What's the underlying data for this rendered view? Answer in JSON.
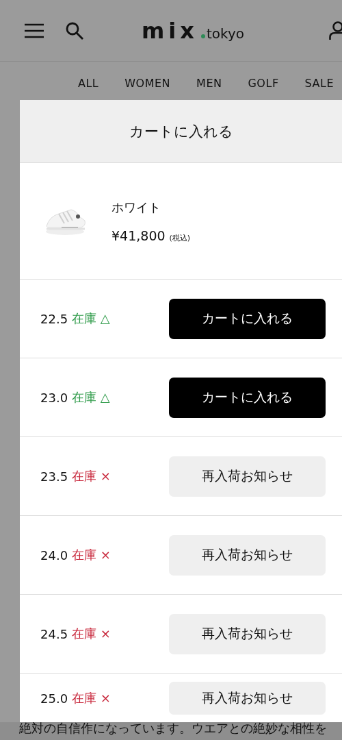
{
  "header": {
    "logo_main": "mix",
    "logo_suffix": "tokyo"
  },
  "nav": [
    "ALL",
    "WOMEN",
    "MEN",
    "GOLF",
    "SALE"
  ],
  "modal": {
    "title": "カートに入れる",
    "product": {
      "kind": "picture",
      "color_name": "ホワイト",
      "price": "¥41,800",
      "tax_note": "(税込)"
    },
    "sizes": [
      {
        "size": "22.5",
        "stock_label": "在庫",
        "stock_mark": "△",
        "in_stock": true,
        "kind": "cart",
        "button": "カートに入れる"
      },
      {
        "size": "23.0",
        "stock_label": "在庫",
        "stock_mark": "△",
        "in_stock": true,
        "kind": "cart",
        "button": "カートに入れる"
      },
      {
        "size": "23.5",
        "stock_label": "在庫",
        "stock_mark": "×",
        "in_stock": false,
        "kind": "notify",
        "button": "再入荷お知らせ"
      },
      {
        "size": "24.0",
        "stock_label": "在庫",
        "stock_mark": "×",
        "in_stock": false,
        "kind": "notify",
        "button": "再入荷お知らせ"
      },
      {
        "size": "24.5",
        "stock_label": "在庫",
        "stock_mark": "×",
        "in_stock": false,
        "kind": "notify",
        "button": "再入荷お知らせ"
      },
      {
        "size": "25.0",
        "stock_label": "在庫",
        "stock_mark": "×",
        "in_stock": false,
        "kind": "notify",
        "button": "再入荷お知らせ"
      }
    ]
  },
  "background_text": "絶対の自信作になっています。ウエアとの絶妙な相性を"
}
